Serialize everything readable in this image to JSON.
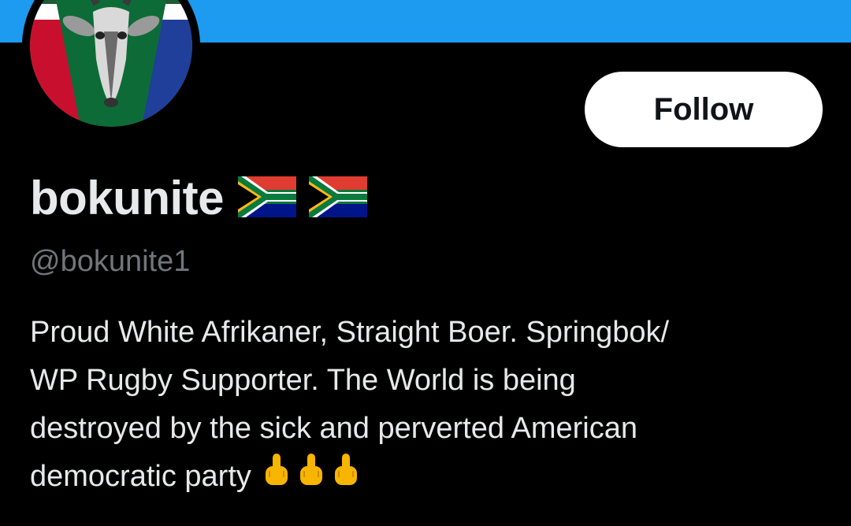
{
  "profile": {
    "display_name": "bokunite",
    "handle": "@bokunite1",
    "follow_label": "Follow",
    "avatar_icon": "springbok-avatar-icon",
    "name_emoji": [
      "south-africa-flag-icon",
      "south-africa-flag-icon"
    ],
    "bio_lines": [
      "Proud White Afrikaner, Straight Boer. Springbok/",
      "WP Rugby Supporter. The World is being",
      "destroyed by the sick and perverted American",
      "democratic party"
    ],
    "bio_emoji": [
      "middle-finger-icon",
      "middle-finger-icon",
      "middle-finger-icon"
    ]
  },
  "colors": {
    "banner": "#1d9bf0",
    "background": "#000000",
    "primary_text": "#e7e9ea",
    "secondary_text": "#71767b",
    "follow_bg": "#ffffff",
    "follow_text": "#0f1419"
  }
}
